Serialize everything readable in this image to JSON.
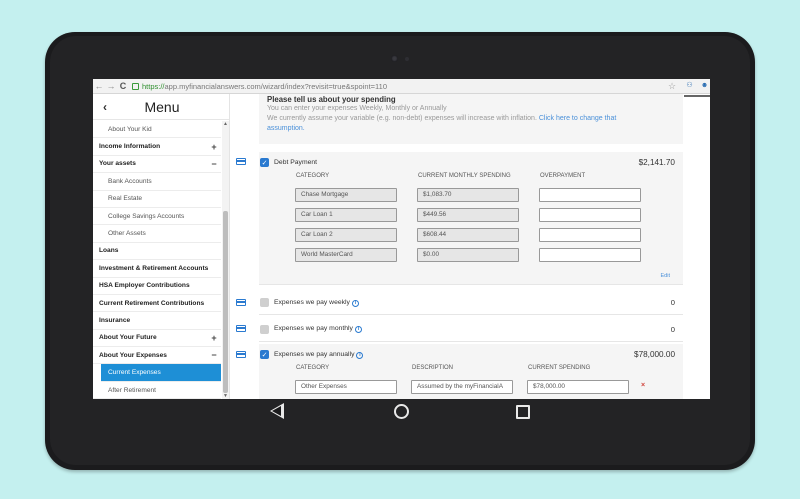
{
  "browser": {
    "url_secure": "https://",
    "url_rest": "app.myfinancialanswers.com/wizard/index?revisit=true&spoint=110",
    "back_glyph": "←",
    "forward_glyph": "→",
    "reload_glyph": "C",
    "star_glyph": "☆",
    "ext1_glyph": "⚇",
    "ext2_glyph": "☻"
  },
  "sidebar": {
    "back_glyph": "‹",
    "title": "Menu",
    "items": [
      {
        "label": "About Your Kid",
        "toggle": ""
      },
      {
        "label": "Income Information",
        "toggle": "+"
      },
      {
        "label": "Your assets",
        "toggle": "−"
      },
      {
        "label": "Bank Accounts",
        "toggle": ""
      },
      {
        "label": "Real Estate",
        "toggle": ""
      },
      {
        "label": "College Savings Accounts",
        "toggle": ""
      },
      {
        "label": "Other Assets",
        "toggle": ""
      },
      {
        "label": "Loans",
        "toggle": ""
      },
      {
        "label": "Investment & Retirement Accounts",
        "toggle": ""
      },
      {
        "label": "HSA Employer Contributions",
        "toggle": ""
      },
      {
        "label": "Current Retirement Contributions",
        "toggle": ""
      },
      {
        "label": "Insurance",
        "toggle": ""
      },
      {
        "label": "About Your Future",
        "toggle": "+"
      },
      {
        "label": "About Your Expenses",
        "toggle": "−"
      },
      {
        "label": "Current Expenses",
        "toggle": ""
      },
      {
        "label": "After Retirement",
        "toggle": ""
      }
    ]
  },
  "intro": {
    "title": "Please tell us about your spending",
    "line1": "You can enter your expenses Weekly, Monthly or Annually",
    "line2": "We currently assume your variable (e.g. non-debt) expenses will increase with inflation. ",
    "link": "Click here to change that",
    "link2": "assumption."
  },
  "debt": {
    "title": "Debt Payment",
    "amount": "$2,141.70",
    "col_category": "CATEGORY",
    "col_current": "CURRENT MONTHLY SPENDING",
    "col_over": "OVERPAYMENT",
    "rows": [
      {
        "category": "Chase Mortgage",
        "current": "$1,083.70",
        "over": ""
      },
      {
        "category": "Car Loan 1",
        "current": "$449.56",
        "over": ""
      },
      {
        "category": "Car Loan 2",
        "current": "$608.44",
        "over": ""
      },
      {
        "category": "World MasterCard",
        "current": "$0.00",
        "over": ""
      }
    ],
    "edit": "Edit"
  },
  "weekly": {
    "title": "Expenses we pay weekly",
    "amount": "0"
  },
  "monthly": {
    "title": "Expenses we pay monthly",
    "amount": "0"
  },
  "annual": {
    "title": "Expenses we pay annually",
    "amount": "$78,000.00",
    "col_category": "CATEGORY",
    "col_description": "DESCRIPTION",
    "col_current": "CURRENT SPENDING",
    "rows": [
      {
        "category": "Other Expenses",
        "description": "Assumed by the myFinancialA",
        "current": "$78,000.00",
        "delete": "×"
      }
    ]
  },
  "glyphs": {
    "check": "✓",
    "info": "i"
  },
  "colors": {
    "accent": "#2a7ad0",
    "active_menu": "#1e8fd6",
    "delete": "#d0433a",
    "background": "#c4f0ef"
  }
}
